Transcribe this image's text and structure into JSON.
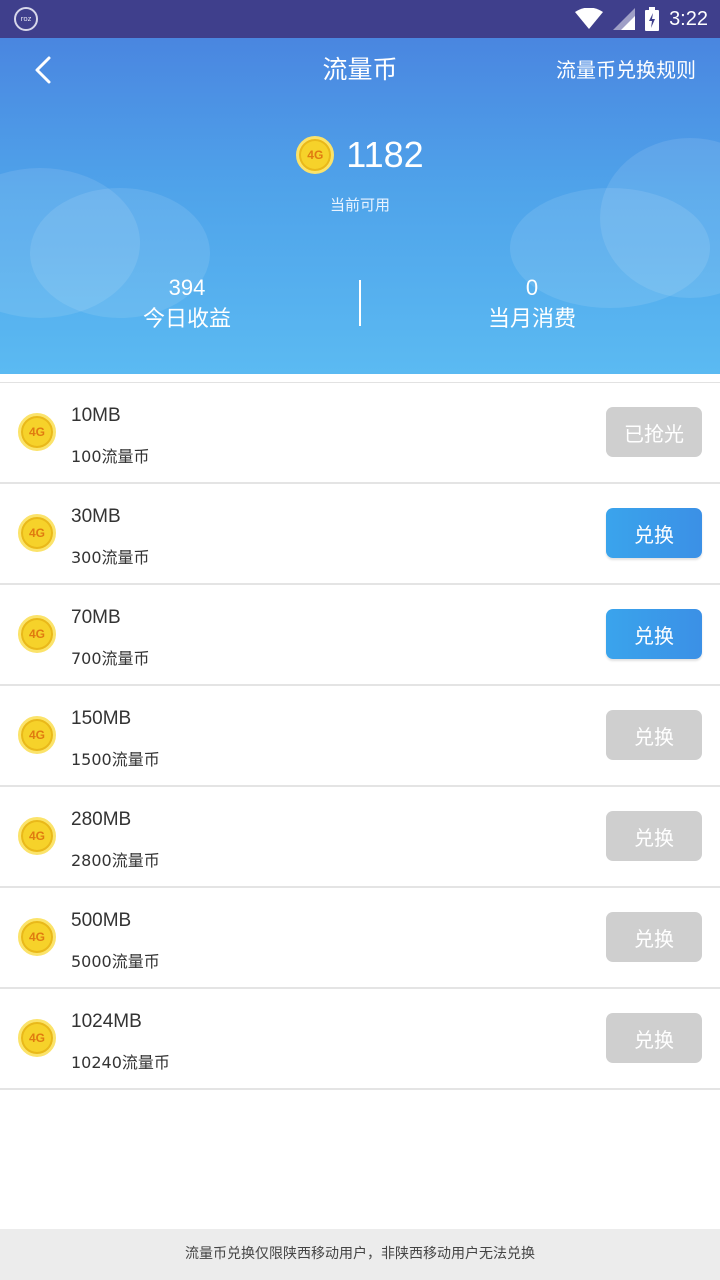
{
  "status_bar": {
    "time": "3:22",
    "left_icon_text": "roz"
  },
  "header": {
    "title": "流量币",
    "rules_link": "流量币兑换规则",
    "balance": "1182",
    "balance_label": "当前可用",
    "today_value": "394",
    "today_label": "今日收益",
    "month_value": "0",
    "month_label": "当月消费"
  },
  "coin_text": "4G",
  "items": [
    {
      "size": "10MB",
      "cost": "100流量币",
      "button": "已抢光",
      "state": "disabled"
    },
    {
      "size": "30MB",
      "cost": "300流量币",
      "button": "兑换",
      "state": "active"
    },
    {
      "size": "70MB",
      "cost": "700流量币",
      "button": "兑换",
      "state": "active"
    },
    {
      "size": "150MB",
      "cost": "1500流量币",
      "button": "兑换",
      "state": "disabled"
    },
    {
      "size": "280MB",
      "cost": "2800流量币",
      "button": "兑换",
      "state": "disabled"
    },
    {
      "size": "500MB",
      "cost": "5000流量币",
      "button": "兑换",
      "state": "disabled"
    },
    {
      "size": "1024MB",
      "cost": "10240流量币",
      "button": "兑换",
      "state": "disabled"
    }
  ],
  "footer": {
    "notice": "流量币兑换仅限陕西移动用户，非陕西移动用户无法兑换"
  },
  "colors": {
    "header_top": "#4a86e0",
    "header_bottom": "#5bbaf2",
    "button_active": "#3b9ae9",
    "button_disabled": "#cfcfcf",
    "coin": "#f6d22a"
  }
}
